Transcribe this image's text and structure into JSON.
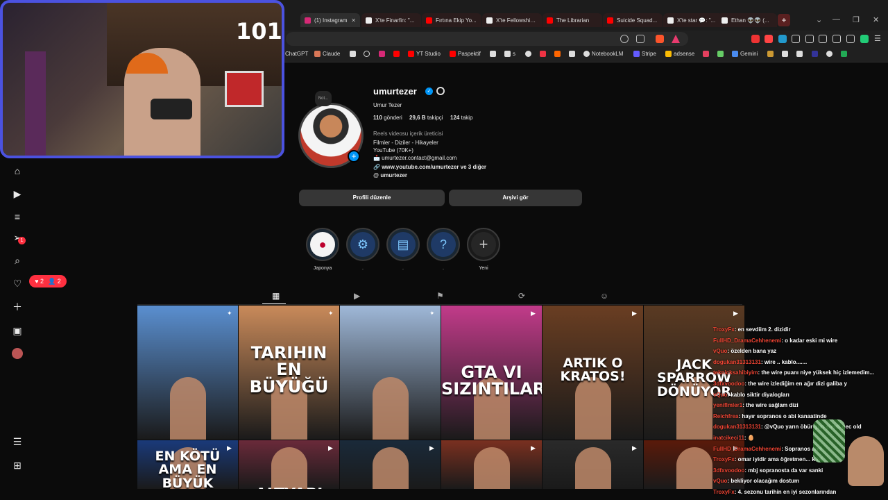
{
  "browser": {
    "tabs": [
      {
        "label": "(1) Instagram",
        "active": true
      },
      {
        "label": "X'te Finarfin: \"...",
        "active": false
      },
      {
        "label": "Fırtına Ekip Yo...",
        "active": false
      },
      {
        "label": "X'te Fellowship...",
        "active": false
      },
      {
        "label": "The Librarian",
        "active": false
      },
      {
        "label": "Suicide Squad...",
        "active": false
      },
      {
        "label": "X'te star 💬: \"...",
        "active": false
      },
      {
        "label": "Ethan 👽👽 (...",
        "active": false
      }
    ],
    "bookmarks": [
      "ChatGPT",
      "Claude",
      "YT Studio",
      "Paspektif",
      "s",
      "NotebookLM",
      "Stripe",
      "adsense",
      "Gemini"
    ]
  },
  "stream": {
    "viewer_count": "101",
    "colors": {
      "frame": "#4b52e0"
    }
  },
  "sidebar": {
    "notifications": {
      "likes": "2",
      "follows": "2"
    },
    "badge_count": "1"
  },
  "profile": {
    "note": "Not...",
    "username": "umurtezer",
    "full_name": "Umur Tezer",
    "posts_count": "110",
    "posts_label": "gönderi",
    "followers_count": "29,6 B",
    "followers_label": "takipçi",
    "following_count": "124",
    "following_label": "takip",
    "category": "Reels videosu içerik üreticisi",
    "bio_lines": [
      "Filmler - Diziler - Hikayeler",
      "YouTube (70K+)",
      "📩 umurtezer.contact@gmail.com"
    ],
    "link": "www.youtube.com/umurtezer ve 3 diğer",
    "threads": "umurtezer",
    "edit_button": "Profili düzenle",
    "archive_button": "Arşivi gör"
  },
  "highlights": [
    {
      "label": "Japonya",
      "icon": "flag-icon"
    },
    {
      "label": ".",
      "icon": "gift-icon"
    },
    {
      "label": ".",
      "icon": "clapper-icon"
    },
    {
      "label": ".",
      "icon": "question-icon"
    },
    {
      "label": "Yeni",
      "icon": "plus-icon"
    }
  ],
  "posts": [
    {
      "caption": "",
      "color": "#5a8fd0"
    },
    {
      "caption": "TARIHIN EN BÜYÜĞÜ",
      "color": "#c98a5a"
    },
    {
      "caption": "",
      "color": "#9fb8d8"
    },
    {
      "caption": "GTA VI SIZINTILARI!",
      "color": "#c23b8a"
    },
    {
      "caption": "ARTIK O KRATOS!",
      "color": "#6a3e22"
    },
    {
      "caption": "JACK SPARROW DÖNÜYOR",
      "color": "#5a3a22"
    },
    {
      "caption": "EN KÖTÜ AMA EN BÜYÜK",
      "color": "#1a3a7a"
    },
    {
      "caption": "ALTYAPI",
      "color": "#6a2a3a"
    },
    {
      "caption": "",
      "color": "#1a2a3a"
    },
    {
      "caption": "",
      "color": "#7a3020"
    },
    {
      "caption": "",
      "color": "#2a2a2a"
    },
    {
      "caption": "",
      "color": "#5a1a0a"
    }
  ],
  "chat": [
    {
      "user": "TroxyFx",
      "msg": ": en sevdiim 2. dizidir"
    },
    {
      "user": "FullHD_DramaCehhenemi",
      "msg": ": o kadar eski mi wire"
    },
    {
      "user": "vQuo",
      "msg": ": özelden bana yaz"
    },
    {
      "user": "dogukan31313131",
      "msg": ": wire .. kablo......."
    },
    {
      "user": "teknicksahibiyim",
      "msg": ": the wire puanı niye yüksek hiç izlemedim..."
    },
    {
      "user": "3dfxvoodoo",
      "msg": ": the wire izlediğim en ağır dizi galiba y"
    },
    {
      "user": "vQuo",
      "msg": ": kablo siktir diyalogları"
    },
    {
      "user": "yeniflmler1",
      "msg": ": the wire sağlam dizi"
    },
    {
      "user": "Reichfrea",
      "msg": ": hayır sopranos o abi kanaatinde"
    },
    {
      "user": "dogukan31313131",
      "msg": ": @vQuo yarın öbür gün şimdi gec old"
    },
    {
      "user": "inatcikeci11",
      "msg": ": 🥚"
    },
    {
      "user": "FullHD_DramaCehhenemi",
      "msg": ": Sopranos and"
    },
    {
      "user": "TroxyFx",
      "msg": ": omar iyidir ama öğretmen... k iyi"
    },
    {
      "user": "3dfxvoodoo",
      "msg": ": mbj sopranosta da var sanki"
    },
    {
      "user": "vQuo",
      "msg": ": bekliyor olacağım dostum"
    },
    {
      "user": "TroxyFx",
      "msg": ": 4. sezonu tarihin en iyi sezonlarından"
    }
  ]
}
